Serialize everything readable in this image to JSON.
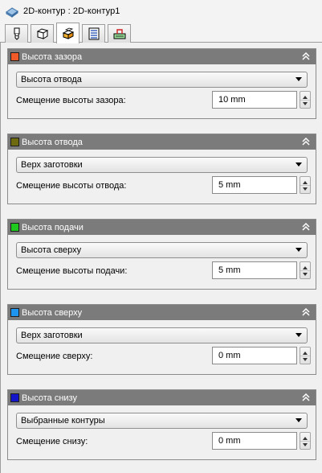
{
  "window": {
    "title": "2D-контур : 2D-контур1",
    "title_icon": "contour-cube-icon"
  },
  "tabs": [
    {
      "icon": "tool-icon",
      "active": false
    },
    {
      "icon": "stock-box-icon",
      "active": false
    },
    {
      "icon": "heights-icon",
      "active": true
    },
    {
      "icon": "passes-icon",
      "active": false
    },
    {
      "icon": "linking-icon",
      "active": false
    }
  ],
  "panels": [
    {
      "title": "Высота зазора",
      "color": "#f05a28",
      "select_value": "Высота отвода",
      "offset_label": "Смещение высоты зазора:",
      "offset_value": "10 mm"
    },
    {
      "title": "Высота отвода",
      "color": "#6e6a10",
      "select_value": "Верх заготовки",
      "offset_label": "Смещение высоты отвода:",
      "offset_value": "5 mm"
    },
    {
      "title": "Высота подачи",
      "color": "#1ec81e",
      "select_value": "Высота сверху",
      "offset_label": "Смещение высоты подачи:",
      "offset_value": "5 mm"
    },
    {
      "title": "Высота сверху",
      "color": "#1e96f0",
      "select_value": "Верх заготовки",
      "offset_label": "Смещение сверху:",
      "offset_value": "0 mm"
    },
    {
      "title": "Высота снизу",
      "color": "#1414c8",
      "select_value": "Выбранные контуры",
      "offset_label": "Смещение снизу:",
      "offset_value": "0 mm"
    }
  ],
  "icons": {
    "collapse": "chevron-double-up-icon",
    "dropdown": "dropdown-arrow-icon",
    "spinner": "spinner-arrows-icon"
  }
}
